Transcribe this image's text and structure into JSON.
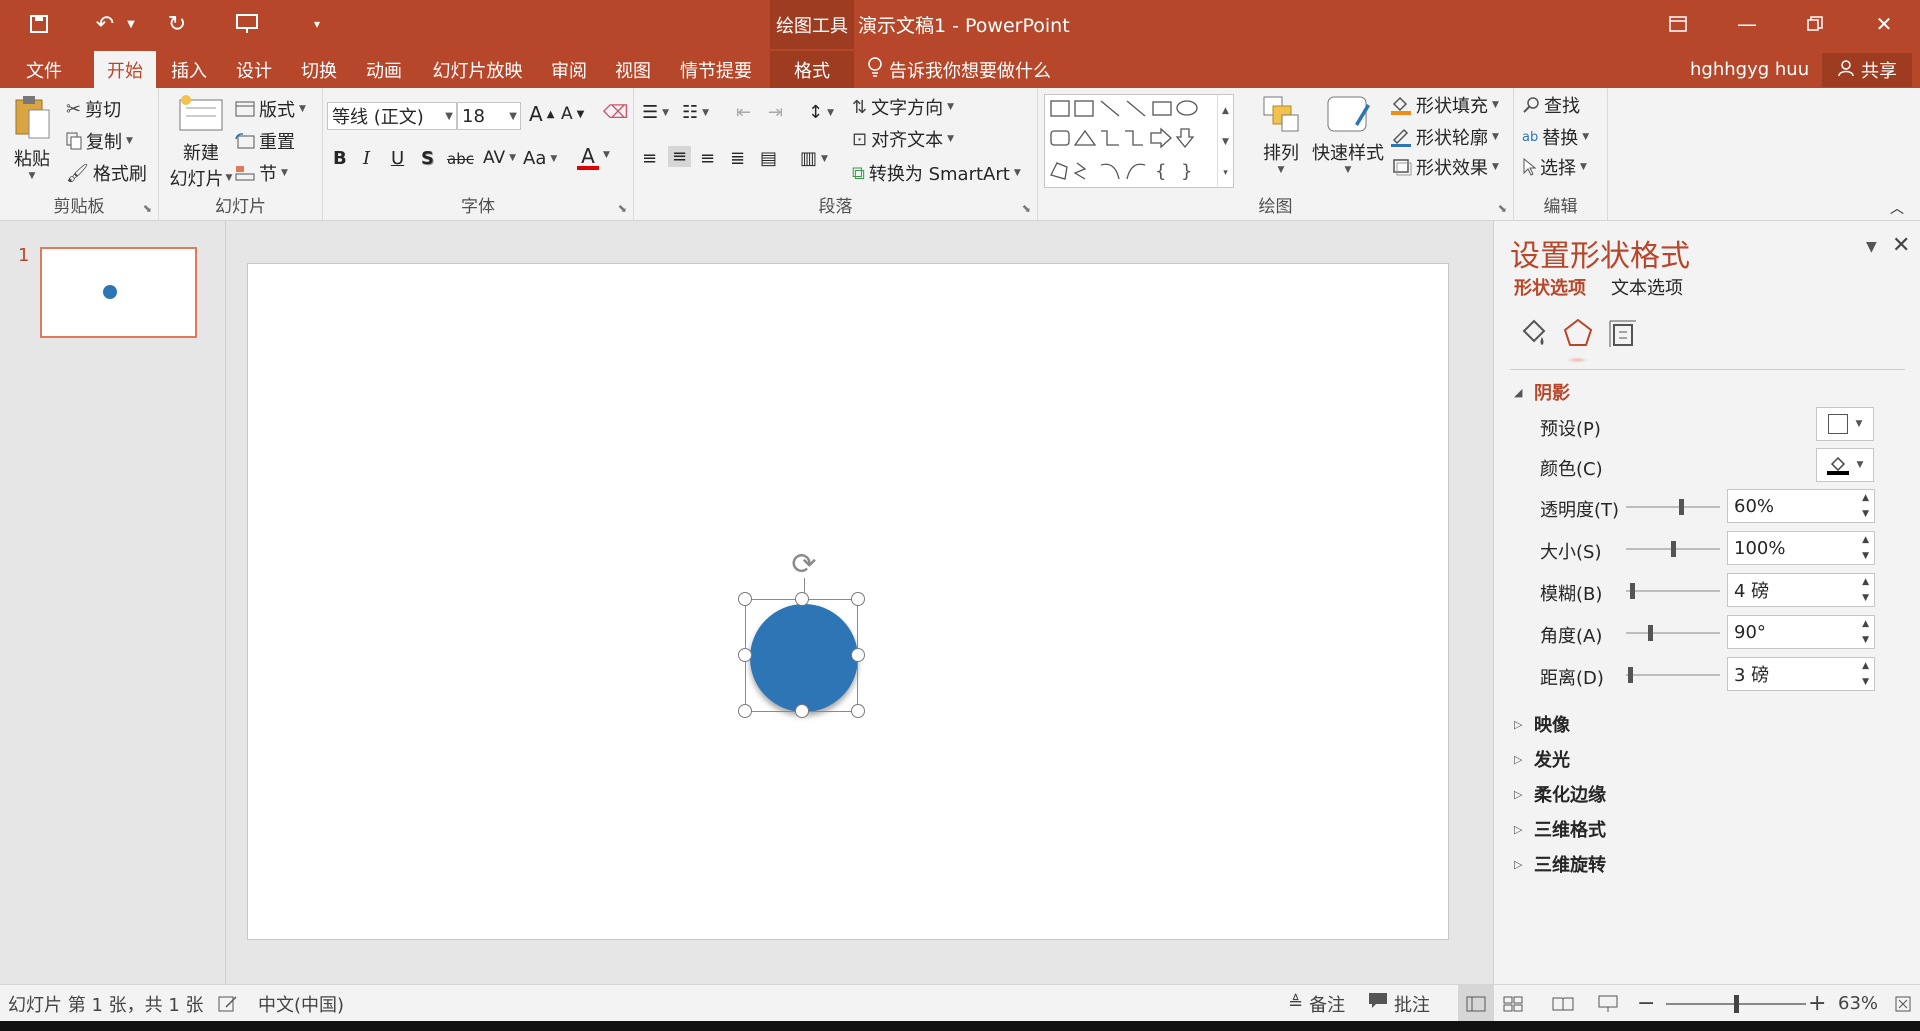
{
  "titlebar": {
    "contextual_label": "绘图工具",
    "doc_title": "演示文稿1 - PowerPoint"
  },
  "menu": {
    "tabs": [
      "文件",
      "开始",
      "插入",
      "设计",
      "切换",
      "动画",
      "幻灯片放映",
      "审阅",
      "视图",
      "情节提要",
      "格式"
    ],
    "tellme": "告诉我你想要做什么",
    "user": "hghhgyg huu",
    "share": "共享"
  },
  "ribbon": {
    "clipboard": {
      "paste": "粘贴",
      "cut": "剪切",
      "copy": "复制",
      "format_painter": "格式刷",
      "label": "剪贴板"
    },
    "slides": {
      "new_line1": "新建",
      "new_line2": "幻灯片",
      "layout": "版式",
      "reset": "重置",
      "section": "节",
      "label": "幻灯片"
    },
    "font": {
      "name": "等线 (正文)",
      "size": "18",
      "label": "字体"
    },
    "paragraph": {
      "text_direction": "文字方向",
      "align_text": "对齐文本",
      "smartart": "转换为 SmartArt",
      "label": "段落"
    },
    "drawing": {
      "arrange": "排列",
      "quick_styles": "快速样式",
      "shape_fill": "形状填充",
      "shape_outline": "形状轮廓",
      "shape_effects": "形状效果",
      "label": "绘图"
    },
    "editing": {
      "find": "查找",
      "replace": "替换",
      "select": "选择",
      "label": "编辑"
    }
  },
  "slides_pane": {
    "slide_number": "1"
  },
  "format_pane": {
    "title": "设置形状格式",
    "tab_shape": "形状选项",
    "tab_text": "文本选项",
    "shadow": {
      "heading": "阴影",
      "preset": "预设(P)",
      "color": "颜色(C)",
      "transparency": {
        "label": "透明度(T)",
        "value": "60%",
        "level": 0.6
      },
      "size": {
        "label": "大小(S)",
        "value": "100%",
        "level": 0.5
      },
      "blur": {
        "label": "模糊(B)",
        "value": "4 磅",
        "level": 0.04
      },
      "angle": {
        "label": "角度(A)",
        "value": "90°",
        "level": 0.25
      },
      "distance": {
        "label": "距离(D)",
        "value": "3 磅",
        "level": 0.02
      }
    },
    "collapsed_sections": [
      "映像",
      "发光",
      "柔化边缘",
      "三维格式",
      "三维旋转"
    ]
  },
  "statusbar": {
    "slide_info": "幻灯片 第 1 张，共 1 张",
    "language": "中文(中国)",
    "notes": "备注",
    "comments": "批注",
    "zoom": "63%",
    "zoom_level": 0.5
  },
  "colors": {
    "accent": "#b7472a",
    "shape_fill": "#2e75b6"
  }
}
